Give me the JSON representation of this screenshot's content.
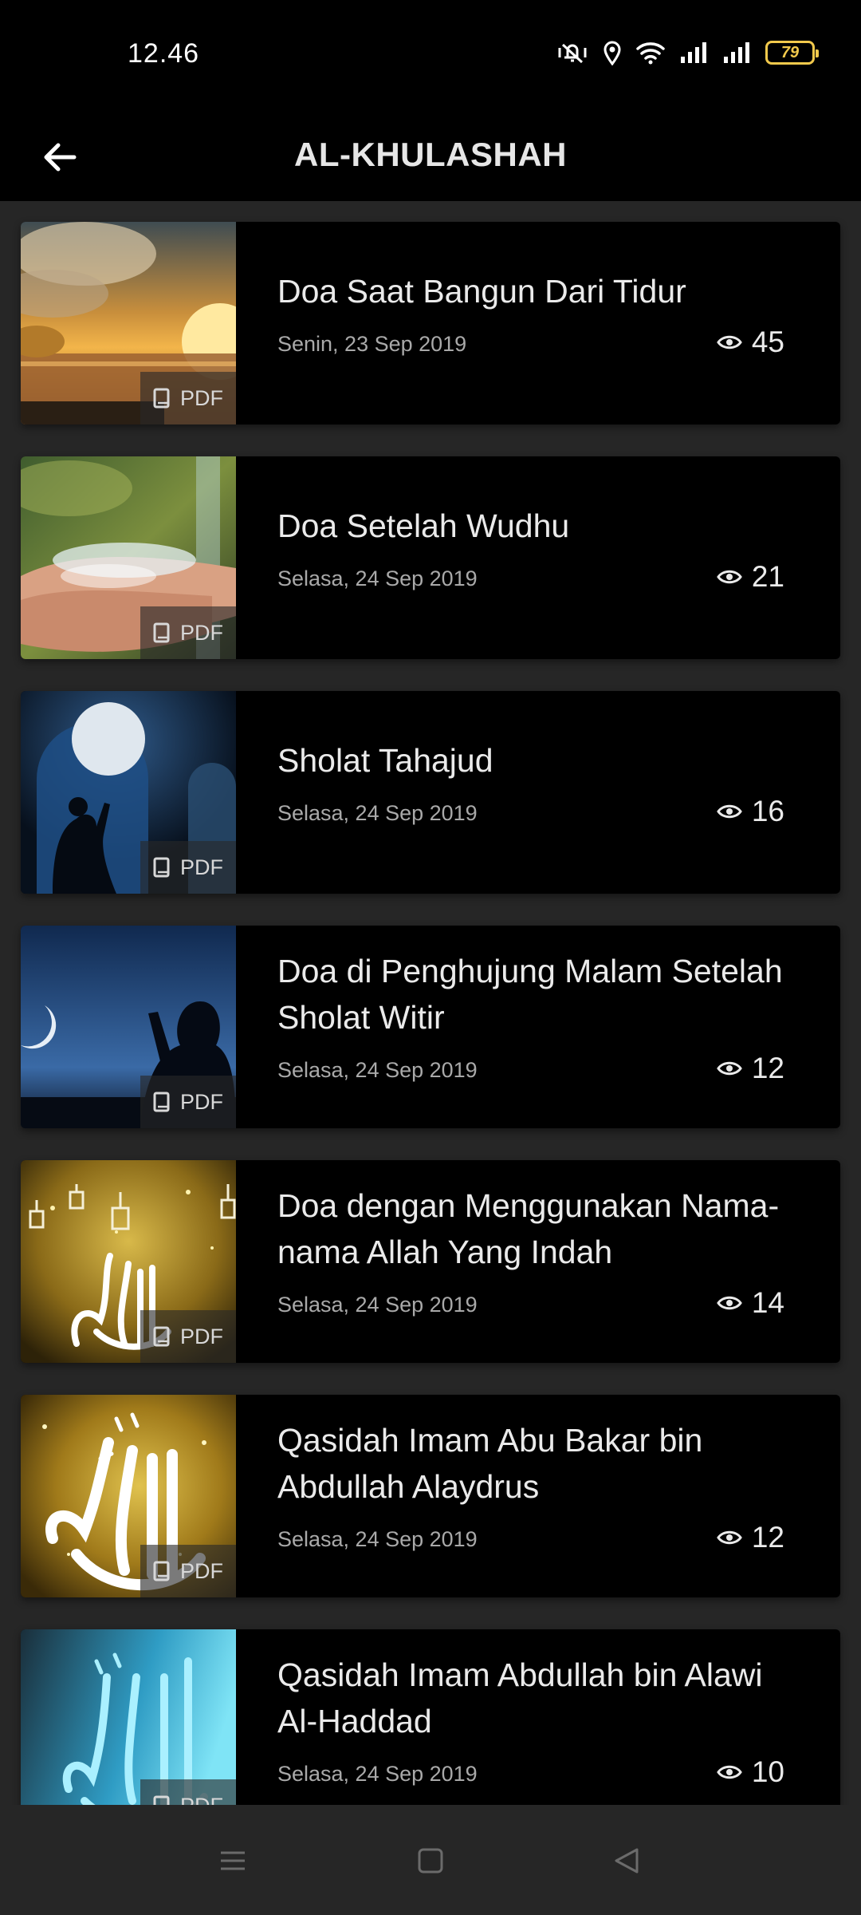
{
  "status_bar": {
    "time": "12.46",
    "battery": "79",
    "icons": [
      "mute-vibrate-icon",
      "location-icon",
      "wifi-icon",
      "signal-icon",
      "signal-icon",
      "battery-icon"
    ]
  },
  "app_bar": {
    "title": "AL-KHULASHAH",
    "back_icon": "arrow-left-icon"
  },
  "items": [
    {
      "title": "Doa Saat Bangun Dari Tidur",
      "date": "Senin, 23 Sep 2019",
      "views": "45",
      "tag": "PDF",
      "thumbnail": "sunrise-over-sea"
    },
    {
      "title": "Doa Setelah Wudhu",
      "date": "Selasa, 24 Sep 2019",
      "views": "21",
      "tag": "PDF",
      "thumbnail": "hands-with-water"
    },
    {
      "title": "Sholat Tahajud",
      "date": "Selasa, 24 Sep 2019",
      "views": "16",
      "tag": "PDF",
      "thumbnail": "praying-under-moon"
    },
    {
      "title": "Doa di Penghujung Malam Setelah Sholat Witir",
      "date": "Selasa, 24 Sep 2019",
      "views": "12",
      "tag": "PDF",
      "thumbnail": "praying-night-sky"
    },
    {
      "title": "Doa dengan Menggunakan Nama-nama Allah Yang Indah",
      "date": "Selasa, 24 Sep 2019",
      "views": "14",
      "tag": "PDF",
      "thumbnail": "gold-calligraphy-lanterns"
    },
    {
      "title": "Qasidah Imam Abu Bakar bin Abdullah Alaydrus",
      "date": "Selasa, 24 Sep 2019",
      "views": "12",
      "tag": "PDF",
      "thumbnail": "gold-calligraphy"
    },
    {
      "title": "Qasidah Imam Abdullah bin Alawi Al-Haddad",
      "date": "Selasa, 24 Sep 2019",
      "views": "10",
      "tag": "PDF",
      "thumbnail": "cyan-calligraphy"
    }
  ],
  "nav_bar": {
    "icons": [
      "menu-icon",
      "home-square-icon",
      "back-triangle-icon"
    ]
  }
}
